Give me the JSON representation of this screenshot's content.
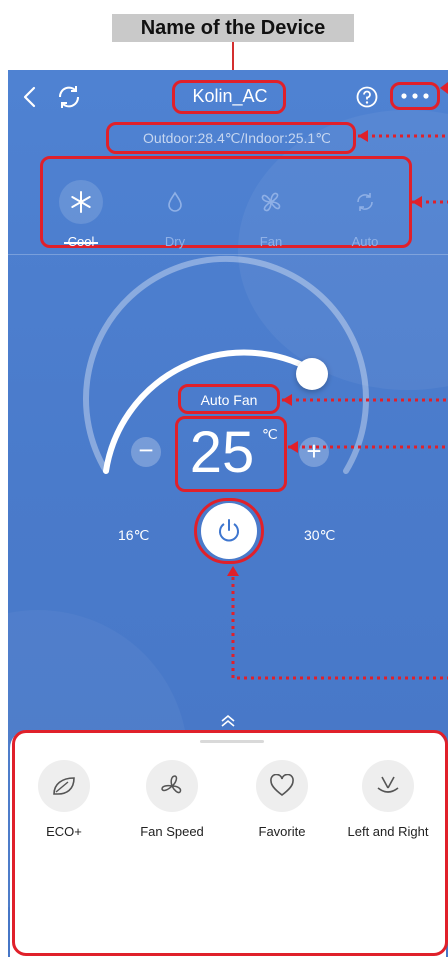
{
  "annotation": {
    "caption": "Name of the Device"
  },
  "header": {
    "device_name": "Kolin_AC",
    "help_icon": "help-circle-icon",
    "more_icon": "more-dots-icon"
  },
  "status": {
    "temperature_text": "Outdoor:28.4℃/Indoor:25.1℃"
  },
  "modes": [
    {
      "label": "Cool",
      "icon": "snowflake-icon",
      "active": true
    },
    {
      "label": "Dry",
      "icon": "droplet-icon",
      "active": false
    },
    {
      "label": "Fan",
      "icon": "fan-icon",
      "active": false
    },
    {
      "label": "Auto",
      "icon": "auto-cycle-icon",
      "active": false
    }
  ],
  "control": {
    "fan_mode": "Auto Fan",
    "set_temperature": "25",
    "unit": "℃",
    "min_label": "16℃",
    "max_label": "30℃",
    "temperature_range": [
      16,
      30
    ]
  },
  "tools": [
    {
      "label": "ECO+",
      "icon": "eco-leaf-icon"
    },
    {
      "label": "Fan Speed",
      "icon": "fan-speed-icon"
    },
    {
      "label": "Favorite",
      "icon": "heart-icon"
    },
    {
      "label": "Left and Right",
      "icon": "swing-icon"
    }
  ],
  "colors": {
    "background": "#4a7bcb",
    "annotation": "#e0202a",
    "tray": "#ffffff"
  }
}
